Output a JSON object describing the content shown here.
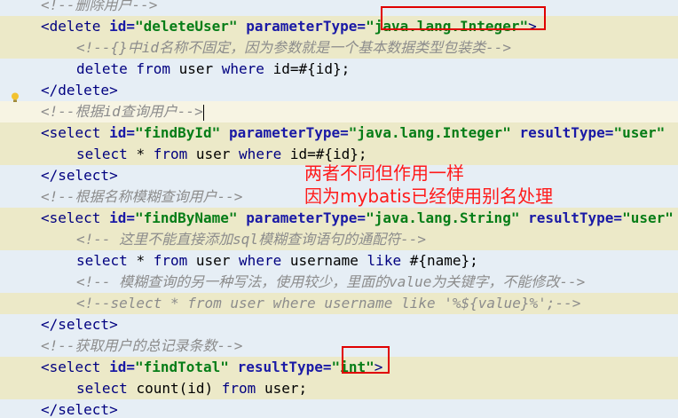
{
  "editor": {
    "lines": [
      {
        "indent": 0,
        "style": "comment",
        "parts": [
          {
            "c": "comment",
            "t": "<!--删除用户-->"
          }
        ]
      },
      {
        "indent": 0,
        "style": "hl",
        "parts": [
          {
            "c": "tag",
            "t": "<delete "
          },
          {
            "c": "attr",
            "t": "id="
          },
          {
            "c": "val",
            "t": "\"deleteUser\""
          },
          {
            "c": "plain",
            "t": " "
          },
          {
            "c": "attr",
            "t": "parameterType="
          },
          {
            "c": "val",
            "t": "\"java.lang.Integer\""
          },
          {
            "c": "tag",
            "t": ">"
          }
        ]
      },
      {
        "indent": 1,
        "style": "hl",
        "parts": [
          {
            "c": "comment",
            "t": "<!--{}中id名称不固定，因为参数就是一个基本数据类型包装类-->"
          }
        ]
      },
      {
        "indent": 1,
        "style": "",
        "parts": [
          {
            "c": "sqlkw",
            "t": "delete from "
          },
          {
            "c": "plain",
            "t": "user "
          },
          {
            "c": "sqlkw",
            "t": "where "
          },
          {
            "c": "plain",
            "t": "id=#{id};"
          }
        ]
      },
      {
        "indent": 0,
        "style": "",
        "parts": [
          {
            "c": "tag",
            "t": "</delete>"
          }
        ]
      },
      {
        "indent": 0,
        "style": "cur",
        "parts": [
          {
            "c": "comment",
            "t": "<!--根据id查询用户-->"
          },
          {
            "c": "cursor",
            "t": ""
          }
        ]
      },
      {
        "indent": 0,
        "style": "hl",
        "parts": [
          {
            "c": "tag",
            "t": "<select "
          },
          {
            "c": "attr",
            "t": "id="
          },
          {
            "c": "val",
            "t": "\"findById\""
          },
          {
            "c": "plain",
            "t": " "
          },
          {
            "c": "attr",
            "t": "parameterType="
          },
          {
            "c": "val",
            "t": "\"java.lang.Integer\""
          },
          {
            "c": "plain",
            "t": " "
          },
          {
            "c": "attr",
            "t": "resultType="
          },
          {
            "c": "val",
            "t": "\"user\""
          }
        ]
      },
      {
        "indent": 1,
        "style": "hl",
        "parts": [
          {
            "c": "sqlkw",
            "t": "select "
          },
          {
            "c": "plain",
            "t": "* "
          },
          {
            "c": "sqlkw",
            "t": "from "
          },
          {
            "c": "plain",
            "t": "user "
          },
          {
            "c": "sqlkw",
            "t": "where "
          },
          {
            "c": "plain",
            "t": "id=#{id};"
          }
        ]
      },
      {
        "indent": 0,
        "style": "",
        "parts": [
          {
            "c": "tag",
            "t": "</select>"
          }
        ]
      },
      {
        "indent": 0,
        "style": "",
        "parts": [
          {
            "c": "comment",
            "t": "<!--根据名称模糊查询用户-->"
          }
        ]
      },
      {
        "indent": 0,
        "style": "hl",
        "parts": [
          {
            "c": "tag",
            "t": "<select "
          },
          {
            "c": "attr",
            "t": "id="
          },
          {
            "c": "val",
            "t": "\"findByName\""
          },
          {
            "c": "plain",
            "t": " "
          },
          {
            "c": "attr",
            "t": "parameterType="
          },
          {
            "c": "val",
            "t": "\"java.lang.String\""
          },
          {
            "c": "plain",
            "t": " "
          },
          {
            "c": "attr",
            "t": "resultType="
          },
          {
            "c": "val",
            "t": "\"user\""
          }
        ]
      },
      {
        "indent": 1,
        "style": "hl",
        "parts": [
          {
            "c": "comment",
            "t": "<!-- 这里不能直接添加sql模糊查询语句的通配符-->"
          }
        ]
      },
      {
        "indent": 1,
        "style": "",
        "parts": [
          {
            "c": "sqlkw",
            "t": "select "
          },
          {
            "c": "plain",
            "t": "* "
          },
          {
            "c": "sqlkw",
            "t": "from "
          },
          {
            "c": "plain",
            "t": "user "
          },
          {
            "c": "sqlkw",
            "t": "where "
          },
          {
            "c": "plain",
            "t": "username "
          },
          {
            "c": "sqlkw",
            "t": "like "
          },
          {
            "c": "plain",
            "t": "#{name};"
          }
        ]
      },
      {
        "indent": 1,
        "style": "",
        "parts": [
          {
            "c": "comment",
            "t": "<!-- 模糊查询的另一种写法，使用较少，里面的value为关键字，不能修改-->"
          }
        ]
      },
      {
        "indent": 1,
        "style": "hl",
        "parts": [
          {
            "c": "comment",
            "t": "<!--select * from user where username like '%${value}%';-->"
          }
        ]
      },
      {
        "indent": 0,
        "style": "",
        "parts": [
          {
            "c": "tag",
            "t": "</select>"
          }
        ]
      },
      {
        "indent": 0,
        "style": "",
        "parts": [
          {
            "c": "comment",
            "t": "<!--获取用户的总记录条数-->"
          }
        ]
      },
      {
        "indent": 0,
        "style": "hl",
        "parts": [
          {
            "c": "tag",
            "t": "<select "
          },
          {
            "c": "attr",
            "t": "id="
          },
          {
            "c": "val",
            "t": "\"findTotal\""
          },
          {
            "c": "plain",
            "t": " "
          },
          {
            "c": "attr",
            "t": "resultType="
          },
          {
            "c": "val",
            "t": "\"int\""
          },
          {
            "c": "tag",
            "t": ">"
          }
        ]
      },
      {
        "indent": 1,
        "style": "hl",
        "parts": [
          {
            "c": "sqlkw",
            "t": "select "
          },
          {
            "c": "plain",
            "t": "count(id) "
          },
          {
            "c": "sqlkw",
            "t": "from "
          },
          {
            "c": "plain",
            "t": "user;"
          }
        ]
      },
      {
        "indent": 0,
        "style": "",
        "parts": [
          {
            "c": "tag",
            "t": "</select>"
          }
        ]
      }
    ]
  },
  "annotation": {
    "line1": "两者不同但作用一样",
    "line2": "因为mybatis已经使用别名处理"
  },
  "colors": {
    "editor_bg": "#e6eef5",
    "highlight_bg": "#ece9c8",
    "annotation_red": "#ff1a1a",
    "box_red": "#e00000"
  }
}
